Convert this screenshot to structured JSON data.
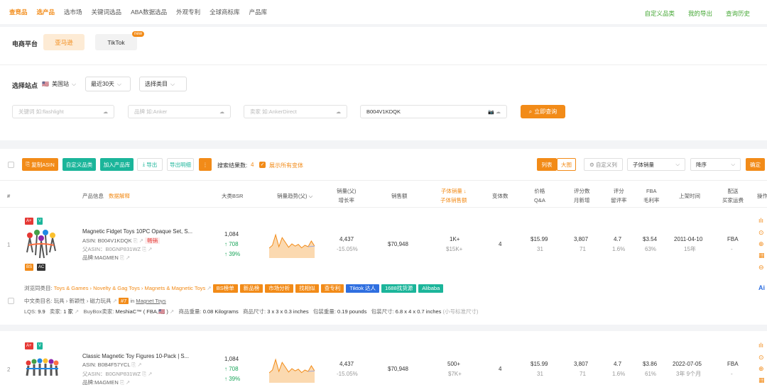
{
  "topnav": {
    "items": [
      "查竞品",
      "选产品",
      "选市场",
      "关键词选品",
      "ABA数据选品",
      "外观专利",
      "全球商标库",
      "产品库"
    ],
    "right": [
      "自定义品类",
      "我的导出",
      "查询历史"
    ]
  },
  "platform": {
    "label": "电商平台",
    "options": [
      "亚马逊",
      "TikTok"
    ],
    "new_badge": "new"
  },
  "filters": {
    "site_label": "选择站点",
    "site": "美国站",
    "period": "最近30天",
    "category": "选择类目",
    "keyword_placeholder": "关键词 如:flashlight",
    "brand_placeholder": "品牌 如:Anker",
    "seller_placeholder": "卖家 如:AnkerDirect",
    "asin_value": "B004V1KDQK",
    "search_btn": "立即查询"
  },
  "toolbar": {
    "copy_asin": "复制ASIN",
    "custom_cat": "自定义品类",
    "add_lib": "加入产品库",
    "export": "导出",
    "export_detail": "导出明细",
    "result_label": "搜索结果数:",
    "result_count": "4",
    "show_variants": "展示所有变体",
    "view_list": "列表",
    "view_grid": "大图",
    "custom_cols": "自定义列",
    "sort_field": "子体销量",
    "sort_order": "降序",
    "confirm": "确定"
  },
  "headers": {
    "idx": "#",
    "info": "产品信息",
    "info_link": "数据解释",
    "bsr": "大类BSR",
    "trend": "销量趋势(父)",
    "sales1": "销量(父)",
    "sales2": "增长率",
    "revenue": "销售额",
    "child1": "子体销量",
    "child2": "子体销售额",
    "variants": "变体数",
    "price1": "价格",
    "price2": "Q&A",
    "rev1": "评分数",
    "rev2": "月新增",
    "rating1": "评分",
    "rating2": "留评率",
    "fba1": "FBA",
    "fba2": "毛利率",
    "date": "上架时间",
    "ship1": "配送",
    "ship2": "买家运费",
    "ops": "操作"
  },
  "rows": [
    {
      "idx": "1",
      "badges": [
        "A+",
        "V",
        "BS",
        "AC"
      ],
      "title": "Magnetic Fidget Toys 10PC Opaque Set, S...",
      "asin": "ASIN: B004V1KDQK",
      "tag_new": "畅销",
      "parent": "父ASIN：B0GNP831WZ",
      "brand": "品牌:MAGMEN",
      "bsr": "1,084",
      "bsr_up": "↑ 708",
      "bsr_pct": "↑ 39%",
      "sales": "4,437",
      "growth": "-15.05%",
      "revenue": "$70,948",
      "child_sales": "1K+",
      "child_rev": "$15K+",
      "variants": "4",
      "price": "$15.99",
      "qa": "31",
      "reviews": "3,807",
      "rev_new": "71",
      "rating": "4.7",
      "rev_rate": "1.6%",
      "fba": "$3.54",
      "margin": "63%",
      "date": "2011-04-10",
      "age": "15年",
      "ship": "FBA",
      "ship_fee": "-",
      "browse_label": "浏览同类目:",
      "browse_path": "Toys & Games › Novelty & Gag Toys › Magnets & Magnetic Toys",
      "tags": [
        "BS榜单",
        "新品榜",
        "市场分析",
        "找相似",
        "查专利",
        "Tiktok 达人",
        "1688找货源",
        "Alibaba"
      ],
      "cn_cat_label": "中文类目名:",
      "cn_cat": "玩具 › 新颖性 › 磁力玩具",
      "rank": "#7",
      "rank_in": "in",
      "rank_cat": "Magnet Toys",
      "lqs_label": "LQS:",
      "lqs": "9.9",
      "seller_label": "卖家:",
      "seller": "1 家",
      "buybox_label": "BuyBox卖家:",
      "buybox": "MeshiaC™ ( FBA,🇺🇸 )",
      "weight_label": "商品重量:",
      "weight": "0.08 Kilograms",
      "dim_label": "商品尺寸:",
      "dim": "3 x 3 x 0.3 inches",
      "pweight_label": "包装重量:",
      "pweight": "0.19 pounds",
      "pdim_label": "包装尺寸:",
      "pdim": "6.8 x 4 x 0.7 inches",
      "size_class": "(小号标准尺寸)",
      "trend_values": [
        0.35,
        0.45,
        0.82,
        0.4,
        0.72,
        0.55,
        0.38,
        0.5,
        0.42,
        0.48,
        0.36,
        0.45,
        0.4,
        0.6,
        0.42
      ]
    },
    {
      "idx": "2",
      "badges": [
        "A+",
        "V"
      ],
      "title": "Classic Magnetic Toy Figures 10-Pack | S...",
      "asin": "ASIN: B0B4F57YCL",
      "parent": "父ASIN：B0GNP831WZ",
      "brand": "品牌:MAGMEN",
      "bsr": "1,084",
      "bsr_up": "↑ 708",
      "bsr_pct": "↑ 39%",
      "sales": "4,437",
      "growth": "-15.05%",
      "revenue": "$70,948",
      "child_sales": "500+",
      "child_rev": "$7K+",
      "variants": "4",
      "price": "$15.99",
      "qa": "31",
      "reviews": "3,807",
      "rev_new": "71",
      "rating": "4.7",
      "rev_rate": "1.6%",
      "fba": "$3.86",
      "margin": "61%",
      "date": "2022-07-05",
      "age": "3年 9个月",
      "ship": "FBA",
      "ship_fee": "-",
      "trend_values": [
        0.35,
        0.45,
        0.82,
        0.4,
        0.72,
        0.55,
        0.38,
        0.5,
        0.42,
        0.48,
        0.36,
        0.45,
        0.4,
        0.6,
        0.42
      ]
    }
  ],
  "colors": {
    "accent": "#f28b18",
    "green": "#1bb59a",
    "blue": "#2f6fe0"
  }
}
